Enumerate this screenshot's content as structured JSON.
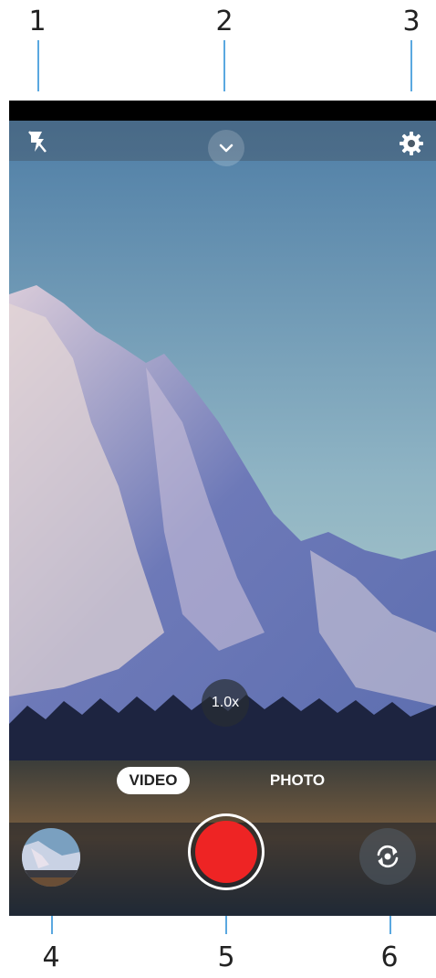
{
  "callouts": [
    "1",
    "2",
    "3",
    "4",
    "5",
    "6"
  ],
  "camera": {
    "zoom_label": "1.0x",
    "modes": {
      "video": "VIDEO",
      "photo": "PHOTO"
    },
    "selected_mode": "VIDEO",
    "record_color": "#ee2424",
    "icons": {
      "flash": "flash-off-icon",
      "expand": "chevron-down-icon",
      "settings": "gear-icon",
      "switch_camera": "camera-switch-icon"
    }
  }
}
